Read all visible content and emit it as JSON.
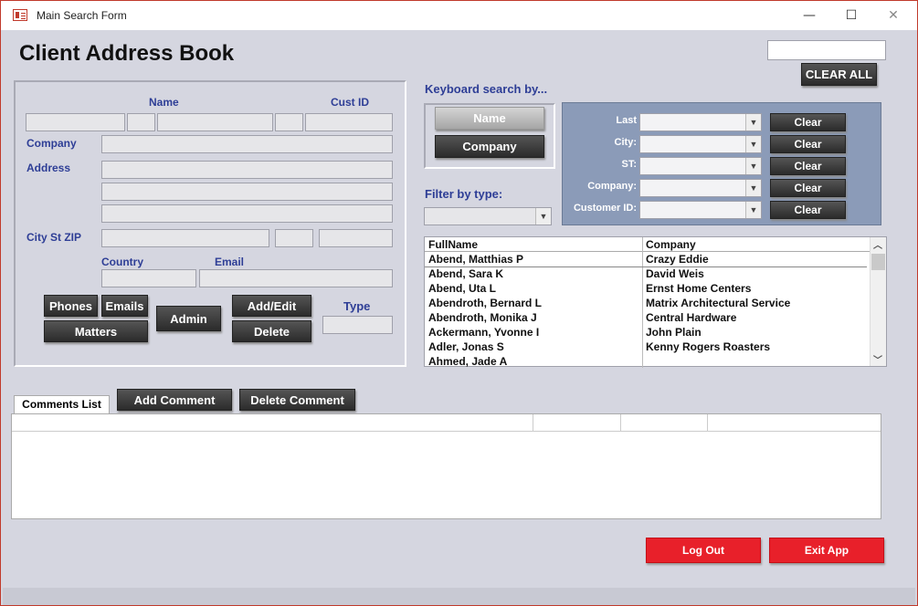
{
  "window": {
    "title": "Main Search Form",
    "minimize": "—",
    "maximize": "☐",
    "close": "✕"
  },
  "header": {
    "title": "Client Address Book",
    "clear_all": "CLEAR ALL"
  },
  "contact": {
    "name_label": "Name",
    "custid_label": "Cust ID",
    "company_label": "Company",
    "address_label": "Address",
    "city_label": "City St ZIP",
    "country_label": "Country",
    "email_label": "Email",
    "type_label": "Type"
  },
  "buttons": {
    "phones": "Phones",
    "emails": "Emails",
    "matters": "Matters",
    "admin": "Admin",
    "add_edit": "Add/Edit",
    "delete": "Delete"
  },
  "search": {
    "title": "Keyboard search by...",
    "name_btn": "Name",
    "company_btn": "Company",
    "filter_label": "Filter by type:",
    "fields": [
      {
        "label": "Last",
        "clear": "Clear"
      },
      {
        "label": "City:",
        "clear": "Clear"
      },
      {
        "label": "ST:",
        "clear": "Clear"
      },
      {
        "label": "Company:",
        "clear": "Clear"
      },
      {
        "label": "Customer ID:",
        "clear": "Clear"
      }
    ]
  },
  "results": {
    "headers": [
      "FullName",
      "Company"
    ],
    "rows": [
      [
        "Abend, Matthias P",
        "Crazy Eddie"
      ],
      [
        "Abend, Sara K",
        "David Weis"
      ],
      [
        "Abend, Uta L",
        "Ernst Home Centers"
      ],
      [
        "Abendroth, Bernard L",
        "Matrix Architectural Service"
      ],
      [
        "Abendroth, Monika J",
        "Central Hardware"
      ],
      [
        "Ackermann, Yvonne I",
        "John Plain"
      ],
      [
        "Adler, Jonas S",
        "Kenny Rogers Roasters"
      ],
      [
        "Ahmed, Jade A",
        ""
      ]
    ]
  },
  "comments": {
    "tab": "Comments List",
    "add": "Add Comment",
    "delete": "Delete Comment"
  },
  "footer": {
    "logout": "Log Out",
    "exit": "Exit App"
  },
  "colors": {
    "accent": "#2e3e96",
    "danger": "#e8202a",
    "panel": "#8b9bb8"
  }
}
